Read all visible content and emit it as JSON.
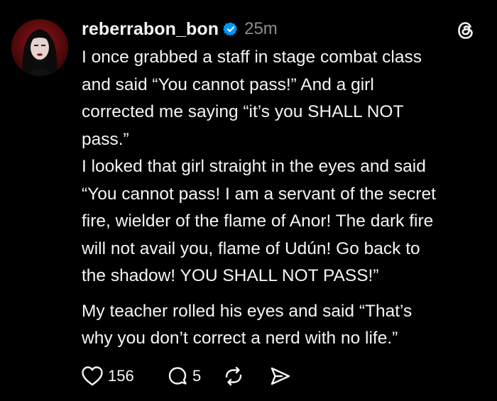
{
  "post": {
    "username": "reberrabon_bon",
    "verified_icon": "verified-badge-icon",
    "timestamp": "25m",
    "app_logo": "threads-logo-icon",
    "paragraphs": [
      "I once grabbed a staff in stage combat class\nand said “You cannot pass!” And a girl\ncorrected me saying “it’s you SHALL NOT\npass.”",
      "I looked that girl straight in the eyes and said\n“You cannot pass! I am a servant of the secret\nfire, wielder of the flame of Anor! The dark fire\nwill not avail you, flame of Udún! Go back to\nthe shadow! YOU SHALL NOT PASS!”",
      "My teacher rolled his eyes and said “That’s\nwhy you don’t correct a nerd with no life.”"
    ],
    "actions": {
      "like_icon": "heart-icon",
      "like_count": "156",
      "reply_icon": "comment-icon",
      "reply_count": "5",
      "repost_icon": "repost-icon",
      "share_icon": "send-icon"
    }
  },
  "colors": {
    "background": "#000000",
    "text": "#f3f5f7",
    "muted": "#8a8d91",
    "verified": "#0095f6"
  }
}
